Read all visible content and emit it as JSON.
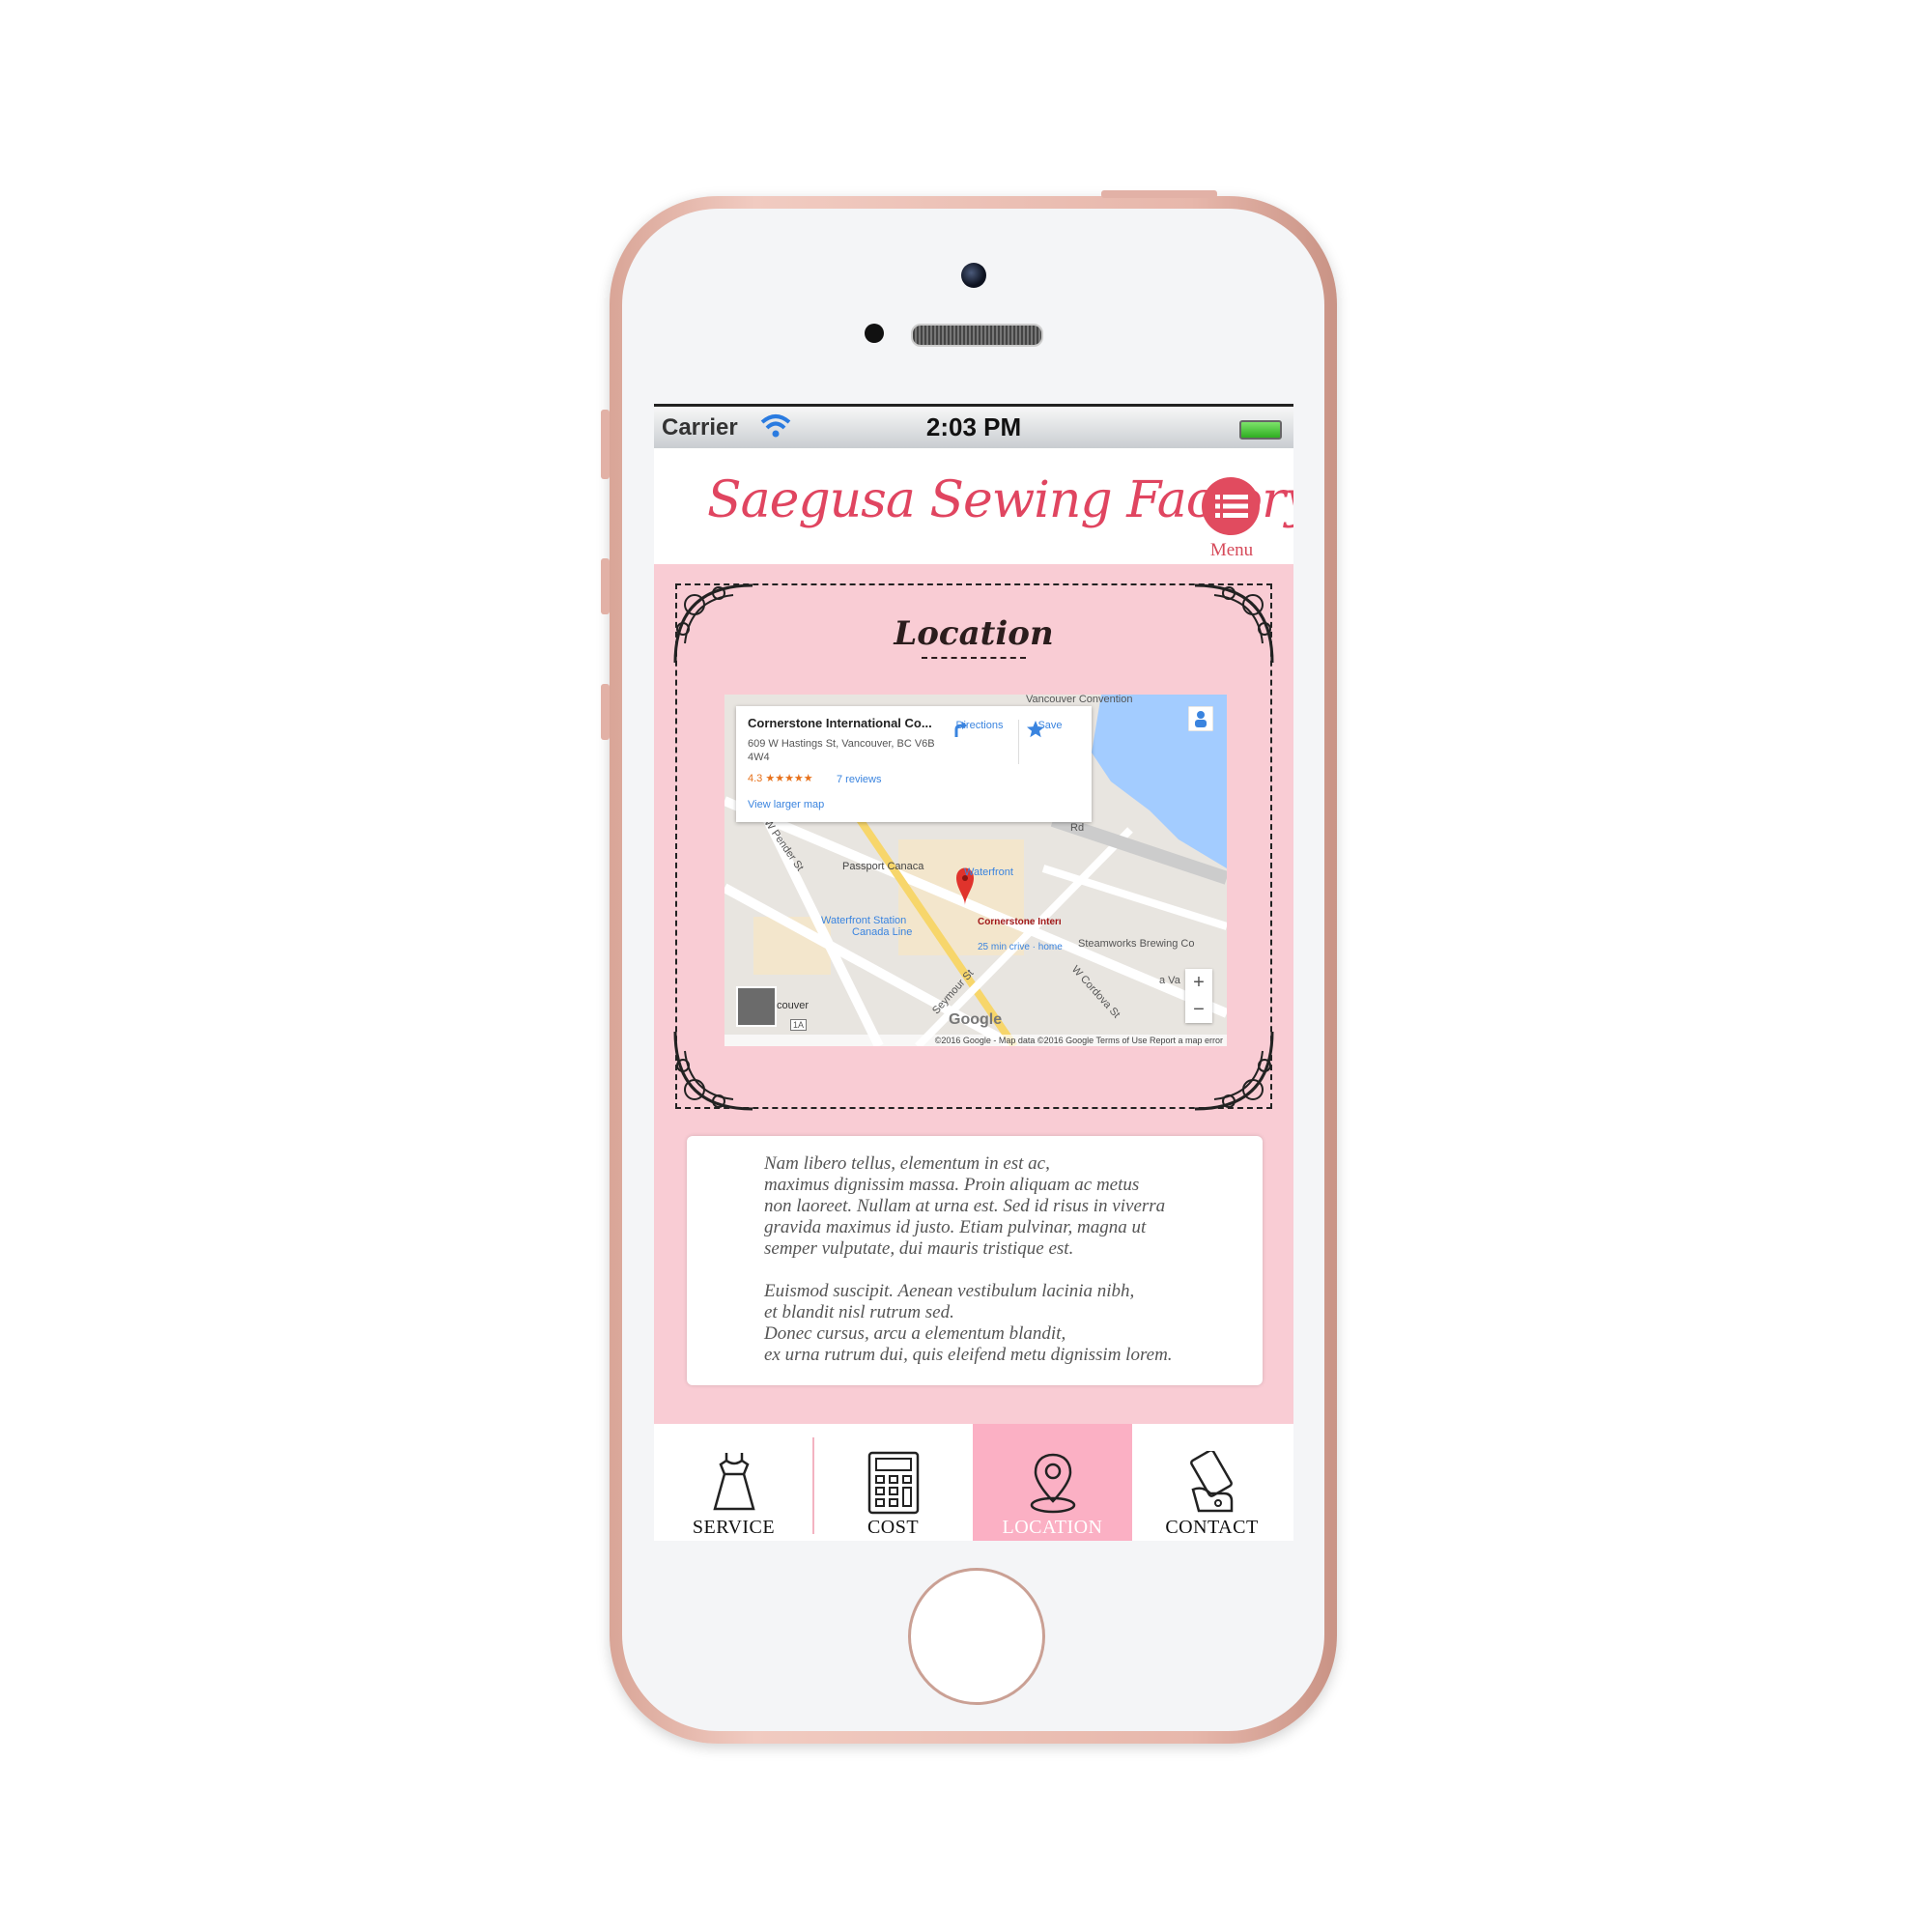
{
  "status_bar": {
    "carrier": "Carrier",
    "time": "2:03 PM"
  },
  "header": {
    "logo": "Saegusa Sewing Factory",
    "menu_label": "Menu",
    "menu_icon": "list-icon"
  },
  "location": {
    "title": "Location",
    "map": {
      "place_name": "Cornerstone International Co...",
      "address": "609 W Hastings St, Vancouver, BC V6B 4W4",
      "rating": "4.3 ★★★★★",
      "reviews": "7 reviews",
      "view_larger": "View larger map",
      "directions": "Directions",
      "save": "Save",
      "labels": {
        "vancouver_convention": "Vancouver Convention",
        "passport_canada": "Passport Canaca",
        "waterfront": "Waterfront",
        "waterfront_station": "Waterfront Station",
        "canada_line": "Canada Line",
        "pin_label": "Cornerstone International...",
        "drive_time": "25 min crive · home",
        "steamworks": "Steamworks Brewing Co",
        "w_pender": "W Pender St",
        "seymour": "Seymour St",
        "w_cordova": "W Cordova St",
        "couver": "couver",
        "route_1a": "1A",
        "ra": "Rd",
        "va": "a Va"
      },
      "zoom_in": "+",
      "zoom_out": "−",
      "google": "Google",
      "attribution": "©2016 Google - Map data ©2016 Google  Terms of Use  Report a map error"
    },
    "paragraph1": "    Nam libero tellus, elementum in est ac,\nmaximus dignissim massa. Proin aliquam ac metus\nnon laoreet. Nullam at urna est. Sed id risus in viverra\ngravida maximus id justo. Etiam pulvinar, magna ut\nsemper vulputate, dui mauris tristique est.",
    "paragraph2": "Euismod suscipit. Aenean vestibulum lacinia nibh,\net blandit nisl rutrum sed.\nDonec cursus, arcu a elementum blandit,\nex urna rutrum dui, quis eleifend metu dignissim lorem."
  },
  "tabs": [
    {
      "label": "SERVICE",
      "icon": "dress-icon",
      "active": false
    },
    {
      "label": "COST",
      "icon": "calculator-icon",
      "active": false
    },
    {
      "label": "LOCATION",
      "icon": "map-pin-icon",
      "active": true
    },
    {
      "label": "CONTACT",
      "icon": "phone-hand-icon",
      "active": false
    }
  ],
  "colors": {
    "accent": "#e14b5f",
    "content_bg": "#f9ccd4",
    "active_tab": "#fbb0c4",
    "frame": "#f1cbc1"
  }
}
